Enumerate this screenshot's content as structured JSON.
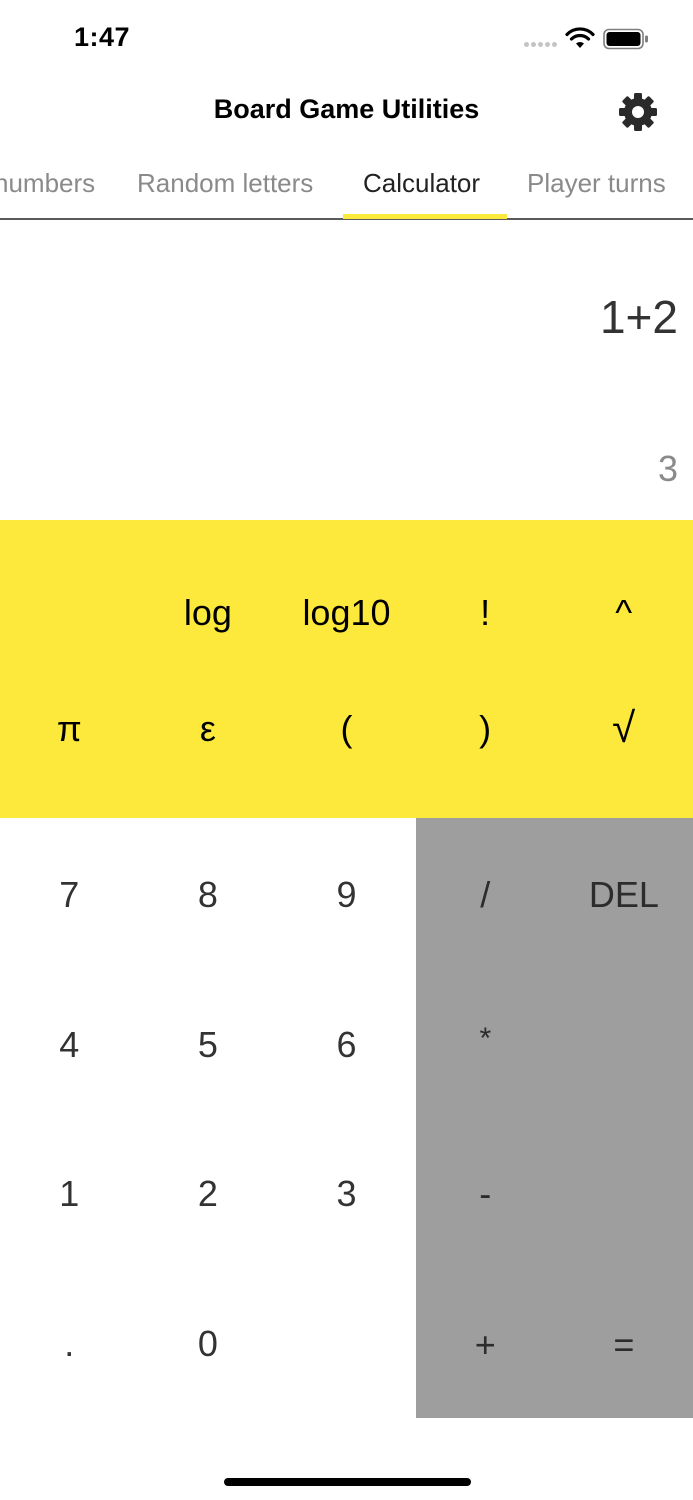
{
  "status_bar": {
    "time": "1:47"
  },
  "header": {
    "title": "Board Game Utilities",
    "settings_icon": "gear-icon"
  },
  "tabs": [
    {
      "label": "numbers",
      "active": false
    },
    {
      "label": "Random letters",
      "active": false
    },
    {
      "label": "Calculator",
      "active": true
    },
    {
      "label": "Player turns",
      "active": false
    }
  ],
  "display": {
    "expression": "1+2",
    "result": "3"
  },
  "scientific_keys": {
    "row1": [
      "log",
      "log10",
      "!",
      "^"
    ],
    "row2": [
      "π",
      "ε",
      "(",
      ")",
      "√"
    ]
  },
  "number_keys": {
    "row1": [
      "7",
      "8",
      "9"
    ],
    "row2": [
      "4",
      "5",
      "6"
    ],
    "row3": [
      "1",
      "2",
      "3"
    ],
    "row4": [
      ".",
      "0"
    ]
  },
  "operator_keys": {
    "divide": "/",
    "delete": "DEL",
    "multiply": "*",
    "subtract": "-",
    "add": "+",
    "equals": "="
  },
  "colors": {
    "accent": "#fde93b",
    "operator_background": "#9e9e9e",
    "inactive_tab": "#8a8a8a"
  }
}
